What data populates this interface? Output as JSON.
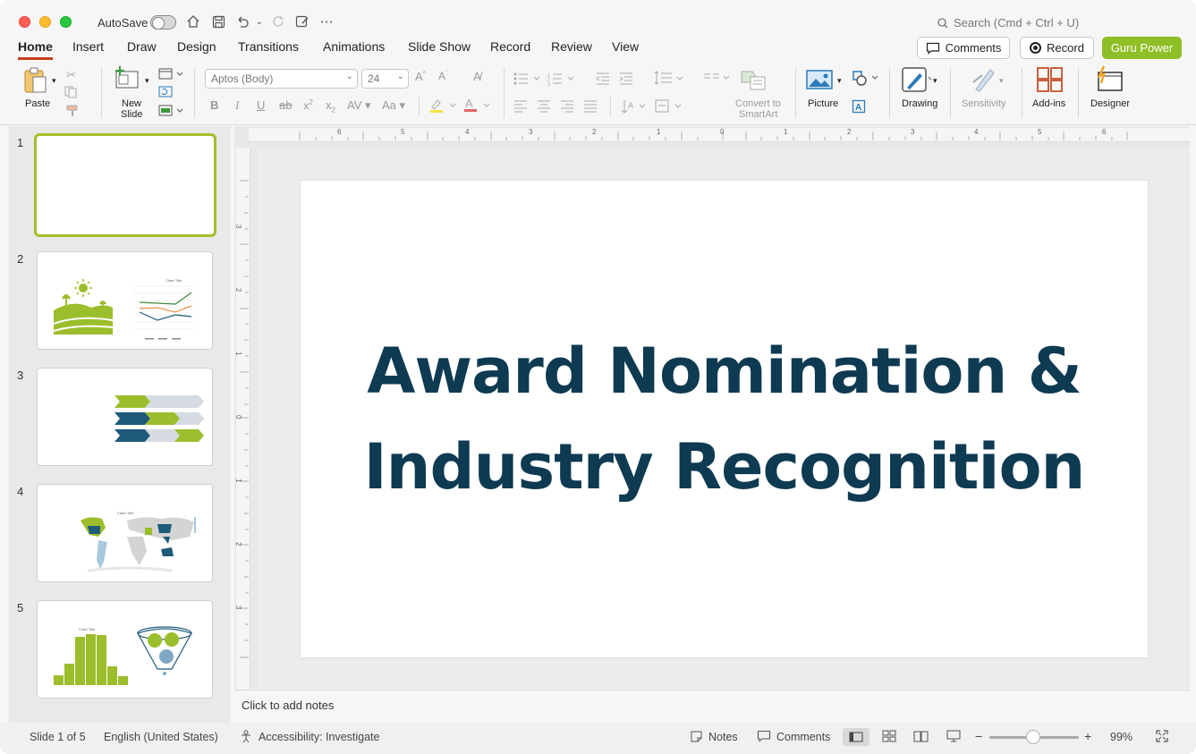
{
  "titlebar": {
    "autosave_label": "AutoSave",
    "search_placeholder": "Search (Cmd + Ctrl + U)"
  },
  "tabs": [
    {
      "label": "Home",
      "active": true
    },
    {
      "label": "Insert"
    },
    {
      "label": "Draw"
    },
    {
      "label": "Design"
    },
    {
      "label": "Transitions"
    },
    {
      "label": "Animations"
    },
    {
      "label": "Slide Show"
    },
    {
      "label": "Record"
    },
    {
      "label": "Review"
    },
    {
      "label": "View"
    }
  ],
  "header_buttons": {
    "comments": "Comments",
    "record": "Record",
    "guru": "Guru Power"
  },
  "ribbon": {
    "paste": "Paste",
    "new_slide_1": "New",
    "new_slide_2": "Slide",
    "font_name": "Aptos (Body)",
    "font_size": "24",
    "convert_1": "Convert to",
    "convert_2": "SmartArt",
    "picture": "Picture",
    "drawing": "Drawing",
    "sensitivity": "Sensitivity",
    "addins": "Add-ins",
    "designer": "Designer"
  },
  "slides": [
    {
      "number": "1"
    },
    {
      "number": "2"
    },
    {
      "number": "3"
    },
    {
      "number": "4"
    },
    {
      "number": "5"
    }
  ],
  "thumb_labels": {
    "chart_title": "Chart Title"
  },
  "slide": {
    "title_line1": "Award Nomination &",
    "title_line2": "Industry Recognition"
  },
  "notes_placeholder": "Click to add notes",
  "status": {
    "slide_of": "Slide 1 of 5",
    "language": "English (United States)",
    "accessibility": "Accessibility: Investigate",
    "notes": "Notes",
    "comments": "Comments",
    "zoom": "99%"
  },
  "colors": {
    "accent_green": "#8fbf26",
    "title_navy": "#0e3a52",
    "tab_underline": "#c43e1c"
  }
}
